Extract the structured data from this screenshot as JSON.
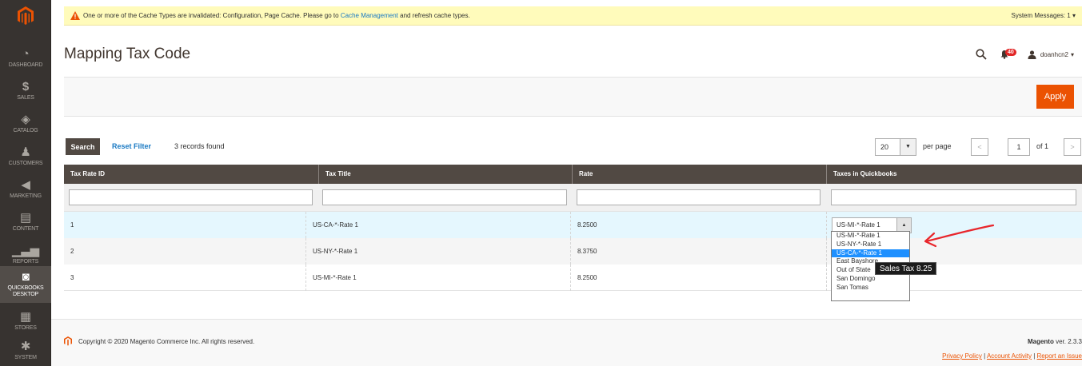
{
  "sidebar": {
    "items": [
      {
        "label": "DASHBOARD",
        "icon": "dashboard-icon"
      },
      {
        "label": "SALES",
        "icon": "dollar-icon"
      },
      {
        "label": "CATALOG",
        "icon": "box-icon"
      },
      {
        "label": "CUSTOMERS",
        "icon": "person-icon"
      },
      {
        "label": "MARKETING",
        "icon": "megaphone-icon"
      },
      {
        "label": "CONTENT",
        "icon": "content-icon"
      },
      {
        "label": "REPORTS",
        "icon": "bar-chart-icon"
      },
      {
        "label": "QUICKBOOKS DESKTOP",
        "icon": "quickbooks-icon"
      },
      {
        "label": "STORES",
        "icon": "store-icon"
      },
      {
        "label": "SYSTEM",
        "icon": "gear-icon"
      }
    ]
  },
  "system_message": {
    "text_before": "One or more of the Cache Types are invalidated: Configuration, Page Cache. Please go to",
    "link": "Cache Management",
    "text_after": "and refresh cache types.",
    "right": "System Messages: 1"
  },
  "header": {
    "title": "Mapping Tax Code",
    "notifications": "40",
    "user": "doanhcn2"
  },
  "actions": {
    "apply": "Apply"
  },
  "toolbar": {
    "search": "Search",
    "reset_filter": "Reset Filter",
    "records_found": "3 records found",
    "per_page_value": "20",
    "per_page_label": "per page",
    "page": "1",
    "of_pages": "of 1"
  },
  "grid": {
    "columns": [
      "Tax Rate ID",
      "Tax Title",
      "Rate",
      "Taxes in Quickbooks"
    ],
    "rows": [
      {
        "id": "1",
        "title": "US-CA-*-Rate 1",
        "rate": "8.2500",
        "qb": "US-MI-*-Rate 1"
      },
      {
        "id": "2",
        "title": "US-NY-*-Rate 1",
        "rate": "8.3750",
        "qb": ""
      },
      {
        "id": "3",
        "title": "US-MI-*-Rate 1",
        "rate": "8.2500",
        "qb": ""
      }
    ]
  },
  "dropdown": {
    "options": [
      "US-MI-*-Rate 1",
      "US-NY-*-Rate 1",
      "US-CA-*-Rate 1",
      "East Bayshore",
      "Out of State",
      "San Domingo",
      "San Tomas"
    ],
    "highlighted": "US-CA-*-Rate 1",
    "tooltip": "Sales Tax 8.25"
  },
  "footer": {
    "copyright": "Copyright © 2020 Magento Commerce Inc. All rights reserved.",
    "brand": "Magento",
    "version": "ver. 2.3.3",
    "links": [
      "Privacy Policy",
      "Account Activity",
      "Report an Issue"
    ]
  },
  "colors": {
    "accent": "#eb5202",
    "sidebar": "#373330",
    "header_row": "#514943",
    "link": "#1979c3"
  }
}
